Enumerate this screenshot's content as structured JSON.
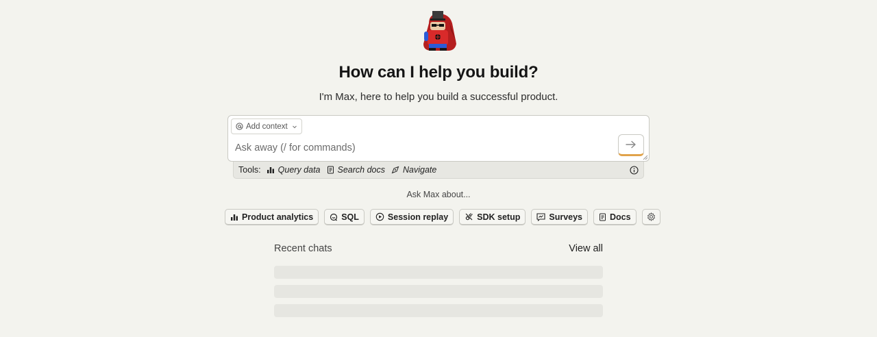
{
  "hero": {
    "mascot_icon": "max-hedgehog-mascot-icon",
    "title": "How can I help you build?",
    "subtitle": "I'm Max, here to help you build a successful product."
  },
  "composer": {
    "context_button": {
      "icon": "at-sign-icon",
      "label": "Add context"
    },
    "input_placeholder": "Ask away (/ for commands)",
    "input_value": "",
    "send_icon": "arrow-right-icon"
  },
  "tools": {
    "label": "Tools:",
    "items": [
      {
        "icon": "bar-chart-icon",
        "label": "Query data"
      },
      {
        "icon": "document-icon",
        "label": "Search docs"
      },
      {
        "icon": "compass-icon",
        "label": "Navigate"
      }
    ],
    "info_icon": "info-icon"
  },
  "suggestions": {
    "label": "Ask Max about...",
    "items": [
      {
        "icon": "bar-chart-icon",
        "label": "Product analytics"
      },
      {
        "icon": "sql-icon",
        "label": "SQL"
      },
      {
        "icon": "replay-icon",
        "label": "Session replay"
      },
      {
        "icon": "plug-off-icon",
        "label": "SDK setup"
      },
      {
        "icon": "survey-icon",
        "label": "Surveys"
      },
      {
        "icon": "document-icon",
        "label": "Docs"
      },
      {
        "icon": "gear-icon",
        "label": ""
      }
    ]
  },
  "recent": {
    "title": "Recent chats",
    "view_all": "View all"
  },
  "colors": {
    "background": "#f3f3ee",
    "send_accent": "#e0a24a",
    "skeleton": "#e6e6e1"
  }
}
